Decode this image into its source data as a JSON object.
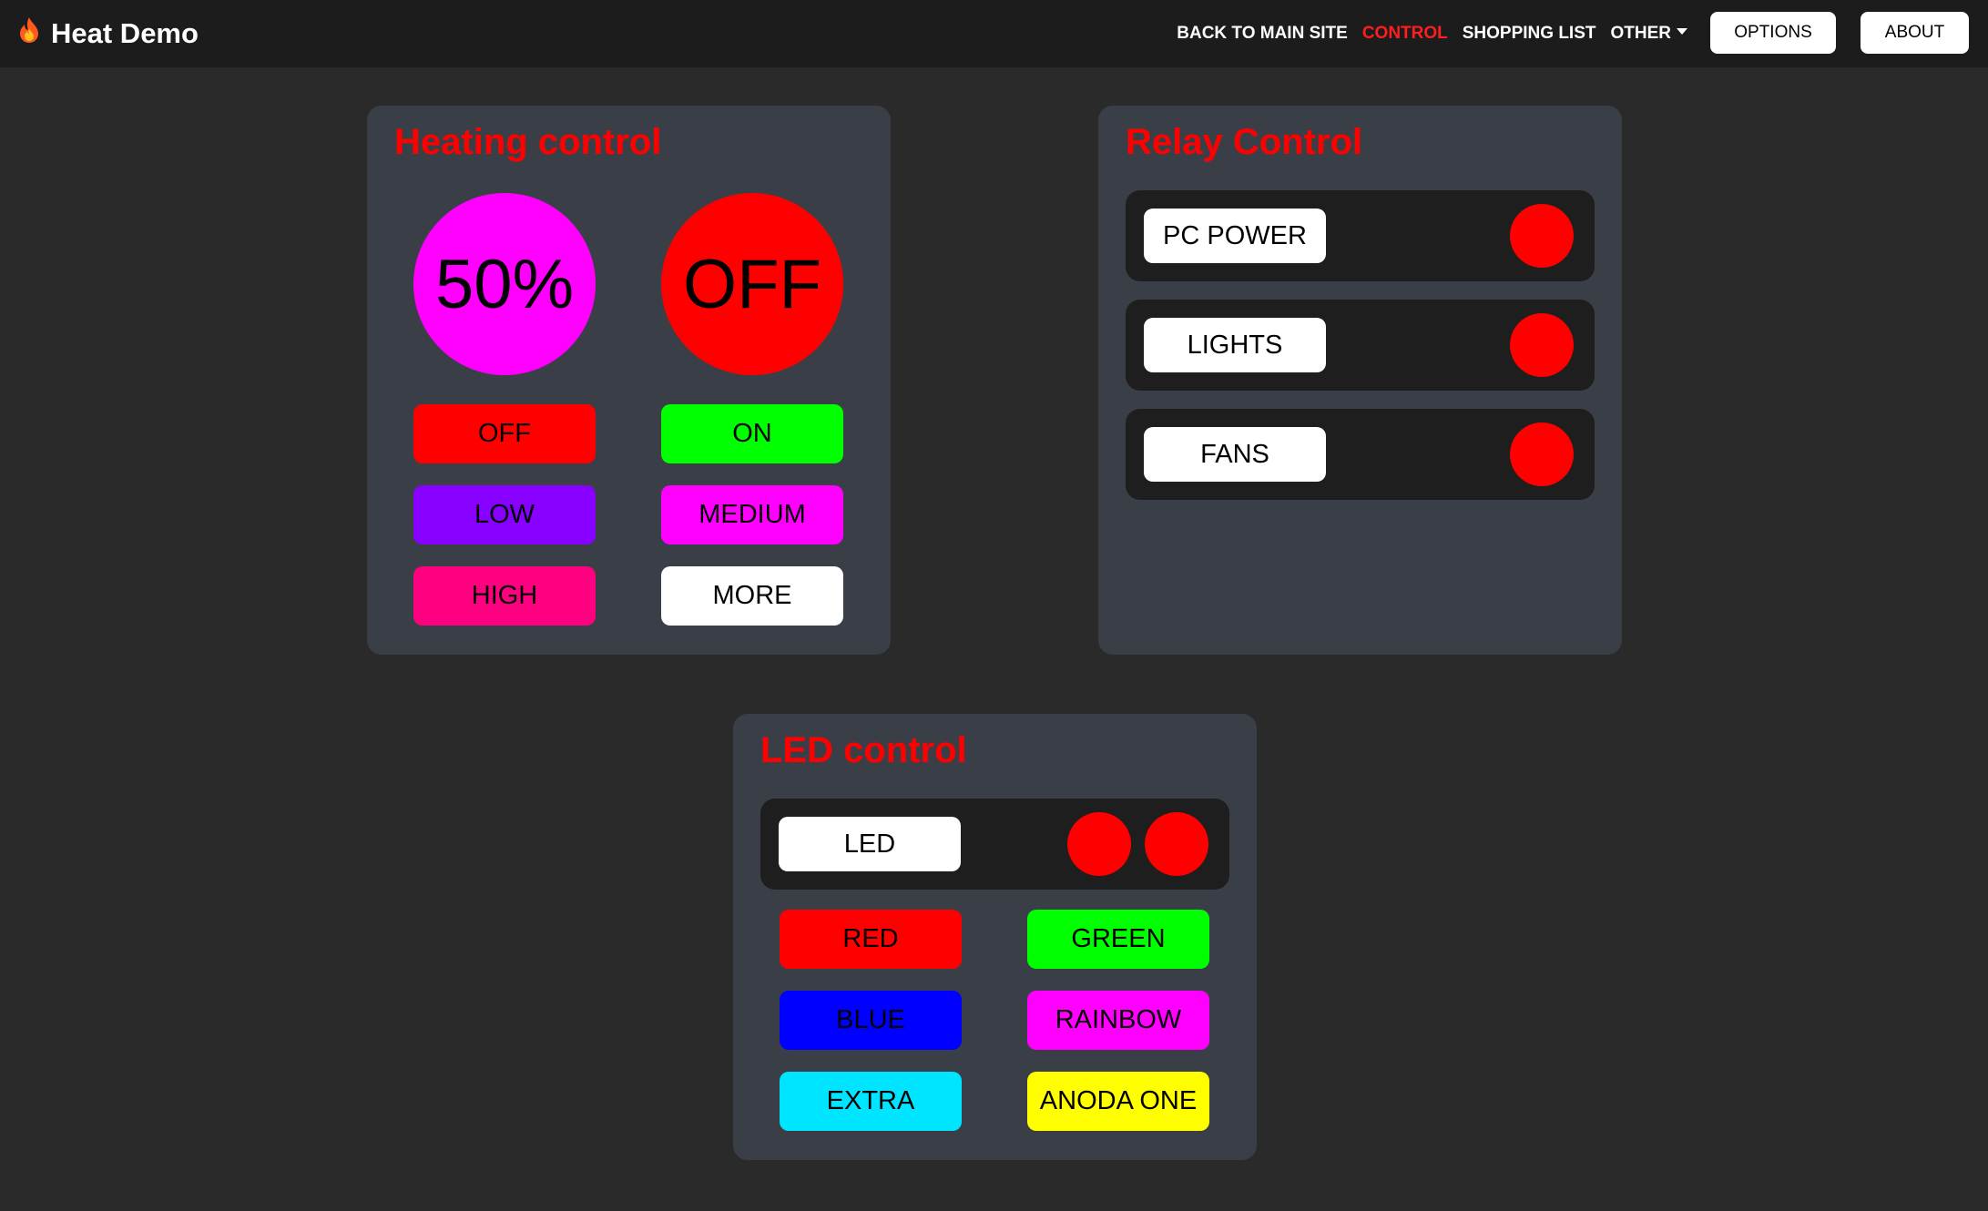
{
  "navbar": {
    "brand": "Heat Demo",
    "brand_icon": "flame-icon",
    "links": [
      {
        "label": "BACK TO MAIN SITE",
        "active": false
      },
      {
        "label": "CONTROL",
        "active": true
      },
      {
        "label": "SHOPPING LIST",
        "active": false
      },
      {
        "label": "OTHER",
        "active": false,
        "dropdown": true
      }
    ],
    "options_label": "OPTIONS",
    "about_label": "ABOUT"
  },
  "heating": {
    "title": "Heating control",
    "level_display": "50%",
    "level_color": "#ff00ff",
    "state_display": "OFF",
    "state_color": "#ff0000",
    "buttons": [
      {
        "label": "OFF",
        "color": "#ff0000"
      },
      {
        "label": "ON",
        "color": "#00ff00"
      },
      {
        "label": "LOW",
        "color": "#8800ff"
      },
      {
        "label": "MEDIUM",
        "color": "#ff00ff"
      },
      {
        "label": "HIGH",
        "color": "#ff0080"
      },
      {
        "label": "MORE",
        "color": "#ffffff"
      }
    ]
  },
  "relay": {
    "title": "Relay Control",
    "items": [
      {
        "label": "PC POWER",
        "status_color": "#ff0000"
      },
      {
        "label": "LIGHTS",
        "status_color": "#ff0000"
      },
      {
        "label": "FANS",
        "status_color": "#ff0000"
      }
    ]
  },
  "led": {
    "title": "LED control",
    "toggle_label": "LED",
    "indicator_colors": [
      "#ff0000",
      "#ff0000"
    ],
    "buttons": [
      {
        "label": "RED",
        "color": "#ff0000"
      },
      {
        "label": "GREEN",
        "color": "#00ff00"
      },
      {
        "label": "BLUE",
        "color": "#0000ff"
      },
      {
        "label": "RAINBOW",
        "color": "#ff00ff"
      },
      {
        "label": "EXTRA",
        "color": "#00e5ff"
      },
      {
        "label": "ANODA ONE",
        "color": "#ffff00"
      }
    ]
  }
}
